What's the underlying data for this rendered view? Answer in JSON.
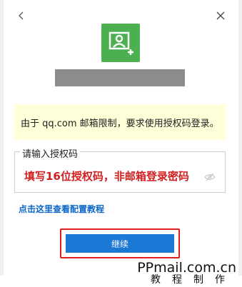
{
  "icons": {
    "back": "chevron-left-icon",
    "close": "close-icon",
    "logo": "add-contact-icon",
    "password_visibility": "eye-off-icon"
  },
  "colors": {
    "logo_bg": "#4caf50",
    "notice_bg": "#ffffd9",
    "accent": "#1b78d4",
    "highlight": "#e02020",
    "link": "#0b67c9",
    "value_text": "#d21f1f"
  },
  "notice": {
    "text": "由于 qq.com 邮箱限制，要求使用授权码登录。"
  },
  "auth_code": {
    "label": "请输入授权码",
    "value": "填写16位授权码，非邮箱登录密码"
  },
  "help_link": {
    "text": "点击这里查看配置教程"
  },
  "continue_button": {
    "label": "继续"
  },
  "watermark": {
    "url": "PPmail.com.cn",
    "caption": "教程制作"
  }
}
